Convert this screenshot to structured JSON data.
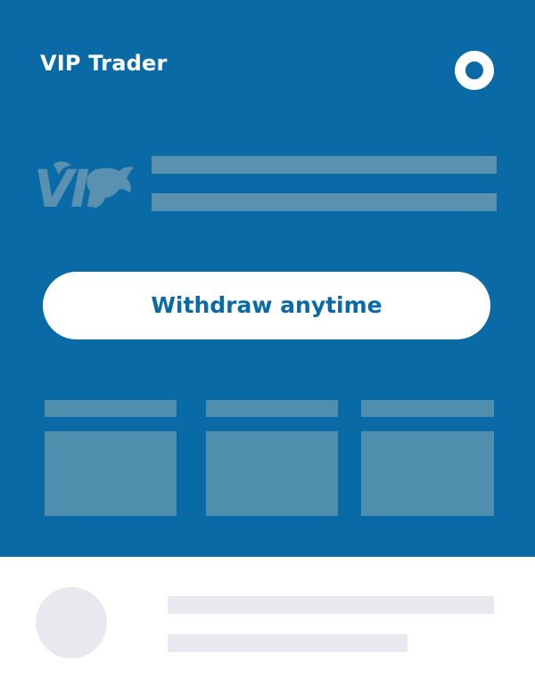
{
  "header": {
    "title": "VIP Trader",
    "settings_icon": "ring-icon"
  },
  "logo": {
    "text": "VIP",
    "emblem": "bull-icon"
  },
  "cta": {
    "label": "Withdraw anytime"
  },
  "colors": {
    "brand_blue": "#0a6aa6",
    "placeholder_blue": "#5a90b0",
    "card_placeholder": "#4f8eac",
    "skeleton_gray": "#e8e8ee",
    "white": "#ffffff"
  }
}
